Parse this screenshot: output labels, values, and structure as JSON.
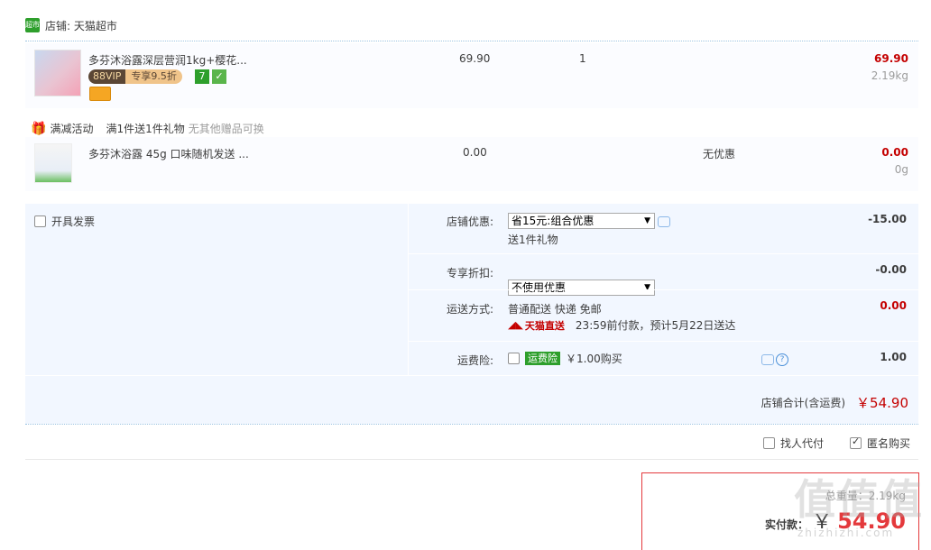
{
  "shop": {
    "logo_text": "超市",
    "label": "店铺: 天猫超市"
  },
  "items": [
    {
      "name": "多芬沐浴露深层营润1kg+樱花...",
      "price": "69.90",
      "qty": "1",
      "subtotal": "69.90",
      "weight": "2.19kg",
      "vip_left": "88VIP",
      "vip_right": "专享9.5折",
      "badge_seven": "7"
    }
  ],
  "gift": {
    "activity_label": "满减活动",
    "rule": "满1件送1件礼物",
    "note": "无其他赠品可换",
    "item": {
      "name": "多芬沐浴露 45g 口味随机发送 ...",
      "price": "0.00",
      "discount": "无优惠",
      "subtotal": "0.00",
      "weight": "0g"
    }
  },
  "options": {
    "invoice_label": "开具发票",
    "shop_discount_label": "店铺优惠:",
    "shop_discount_value": "省15元:组合优惠",
    "shop_discount_sub": "送1件礼物",
    "shop_discount_amount": "-15.00",
    "exclusive_label": "专享折扣:",
    "exclusive_value": "不使用优惠",
    "exclusive_amount": "-0.00",
    "shipping_label": "运送方式:",
    "shipping_value": "普通配送 快递 免邮",
    "tmall_direct": "天猫直送",
    "shipping_note": "23:59前付款，预计5月22日送达",
    "shipping_amount": "0.00",
    "insurance_label": "运费险:",
    "insurance_tag": "运费险",
    "insurance_price": "￥1.00购买",
    "insurance_amount": "1.00",
    "shop_total_label": "店铺合计(含运费)",
    "shop_total_value": "￥54.90"
  },
  "bottom": {
    "proxy_label": "找人代付",
    "anonymous_label": "匿名购买"
  },
  "pay": {
    "weight_label": "总重量：2.19kg",
    "actual_label": "实付款：",
    "currency": "￥",
    "amount": "54.90"
  },
  "watermark": {
    "big": "值值值",
    "small": "zhizhizhi.com"
  },
  "colors": {
    "accent_red": "#c40000",
    "panel_bg": "#f2f7ff",
    "tmall_green": "#2e9f2c"
  }
}
